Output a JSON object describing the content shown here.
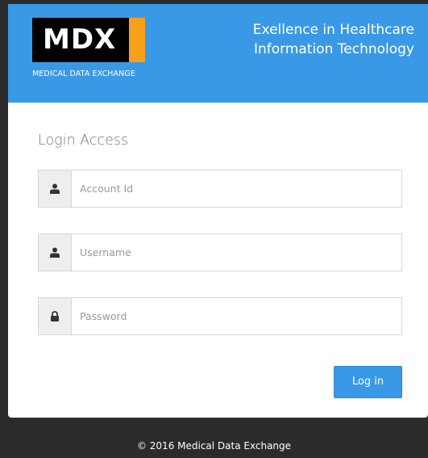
{
  "header": {
    "logo_text": "MDX",
    "logo_subtitle": "MEDICAL DATA EXCHANGE",
    "tagline_line1": "Exellence in Healthcare",
    "tagline_line2": "Information Technology"
  },
  "form": {
    "title": "Login Access",
    "account_id": {
      "placeholder": "Account Id",
      "value": "",
      "icon": "user-icon"
    },
    "username": {
      "placeholder": "Username",
      "value": "",
      "icon": "user-icon"
    },
    "password": {
      "placeholder": "Password",
      "value": "",
      "icon": "lock-icon"
    },
    "login_label": "Log in"
  },
  "footer": {
    "copyright": "© 2016 Medical Data Exchange"
  },
  "colors": {
    "header_blue": "#3a99e6",
    "logo_orange": "#f7a01a",
    "background_dark": "#2b2b2b"
  }
}
